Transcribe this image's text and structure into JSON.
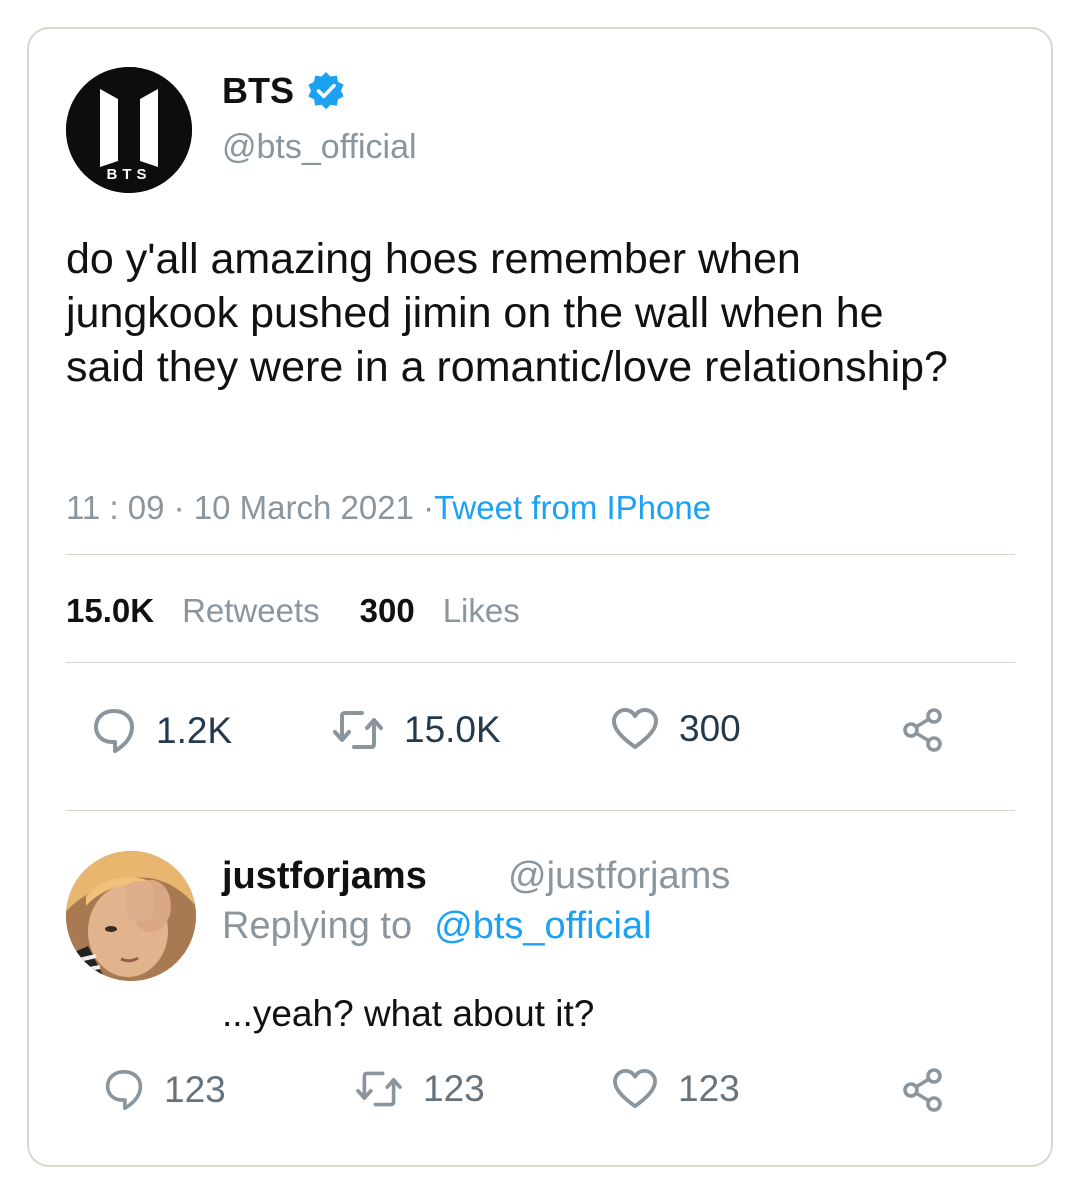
{
  "tweet": {
    "display_name": "BTS",
    "handle": "@bts_official",
    "avatar_label": "BTS",
    "text": "do y'all amazing hoes remember when jungkook pushed jimin on the wall when he said they were in a romantic/love relationship?",
    "time": "11 : 09 · 10 March 2021 ·",
    "source": "Tweet from IPhone",
    "stats": {
      "retweets_count": "15.0K",
      "retweets_label": "Retweets",
      "likes_count": "300",
      "likes_label": "Likes"
    },
    "actions": {
      "reply_count": "1.2K",
      "retweet_count": "15.0K",
      "like_count": "300"
    }
  },
  "reply": {
    "display_name": "justforjams",
    "handle": "@justforjams",
    "replying_to_label": "Replying to",
    "replying_to_handle": "@bts_official",
    "text": "...yeah? what about it?",
    "actions": {
      "reply_count": "123",
      "retweet_count": "123",
      "like_count": "123"
    }
  },
  "colors": {
    "link_blue": "#1da1f2",
    "verified_blue": "#1da1f2",
    "muted_gray": "#8a959e",
    "action_dark": "#233a4e",
    "border": "#d8d8cc"
  },
  "icons": [
    "verified-badge-icon",
    "reply-icon",
    "retweet-icon",
    "like-icon",
    "share-icon"
  ]
}
